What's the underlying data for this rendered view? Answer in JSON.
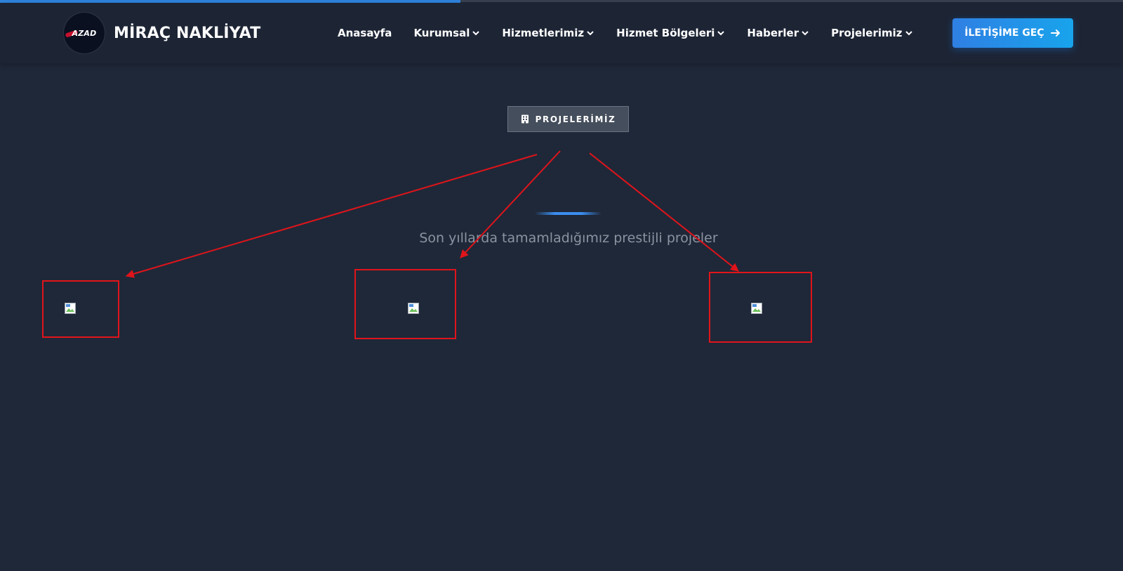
{
  "header": {
    "logo": {
      "mark_text": "AZAD"
    },
    "brand_name": "MİRAÇ NAKLİYAT",
    "nav": [
      {
        "label": "Anasayfa",
        "has_dropdown": false
      },
      {
        "label": "Kurumsal",
        "has_dropdown": true
      },
      {
        "label": "Hizmetlerimiz",
        "has_dropdown": true
      },
      {
        "label": "Hizmet Bölgeleri",
        "has_dropdown": true
      },
      {
        "label": "Haberler",
        "has_dropdown": true
      },
      {
        "label": "Projelerimiz",
        "has_dropdown": true
      }
    ],
    "cta_label": "İLETİŞİME GEÇ"
  },
  "page_progress": {
    "fraction": 0.41
  },
  "section": {
    "badge_label": "PROJELERİMİZ",
    "subtitle": "Son yıllarda tamamladığımız prestijli projeler"
  },
  "projects": [
    {
      "image_status": "broken-image-icon"
    },
    {
      "image_status": "broken-image-icon"
    },
    {
      "image_status": "broken-image-icon"
    }
  ],
  "annotation": {
    "color": "#e0141b",
    "description_icons": [
      "arrow-icon",
      "highlight-box"
    ]
  },
  "colors": {
    "background": "#1f2838",
    "header_bg": "#1d2535",
    "accent": "#2f86e0",
    "cta_gradient_start": "#2f7fe3",
    "cta_gradient_end": "#18a4ec",
    "annotation_red": "#e0141b"
  }
}
